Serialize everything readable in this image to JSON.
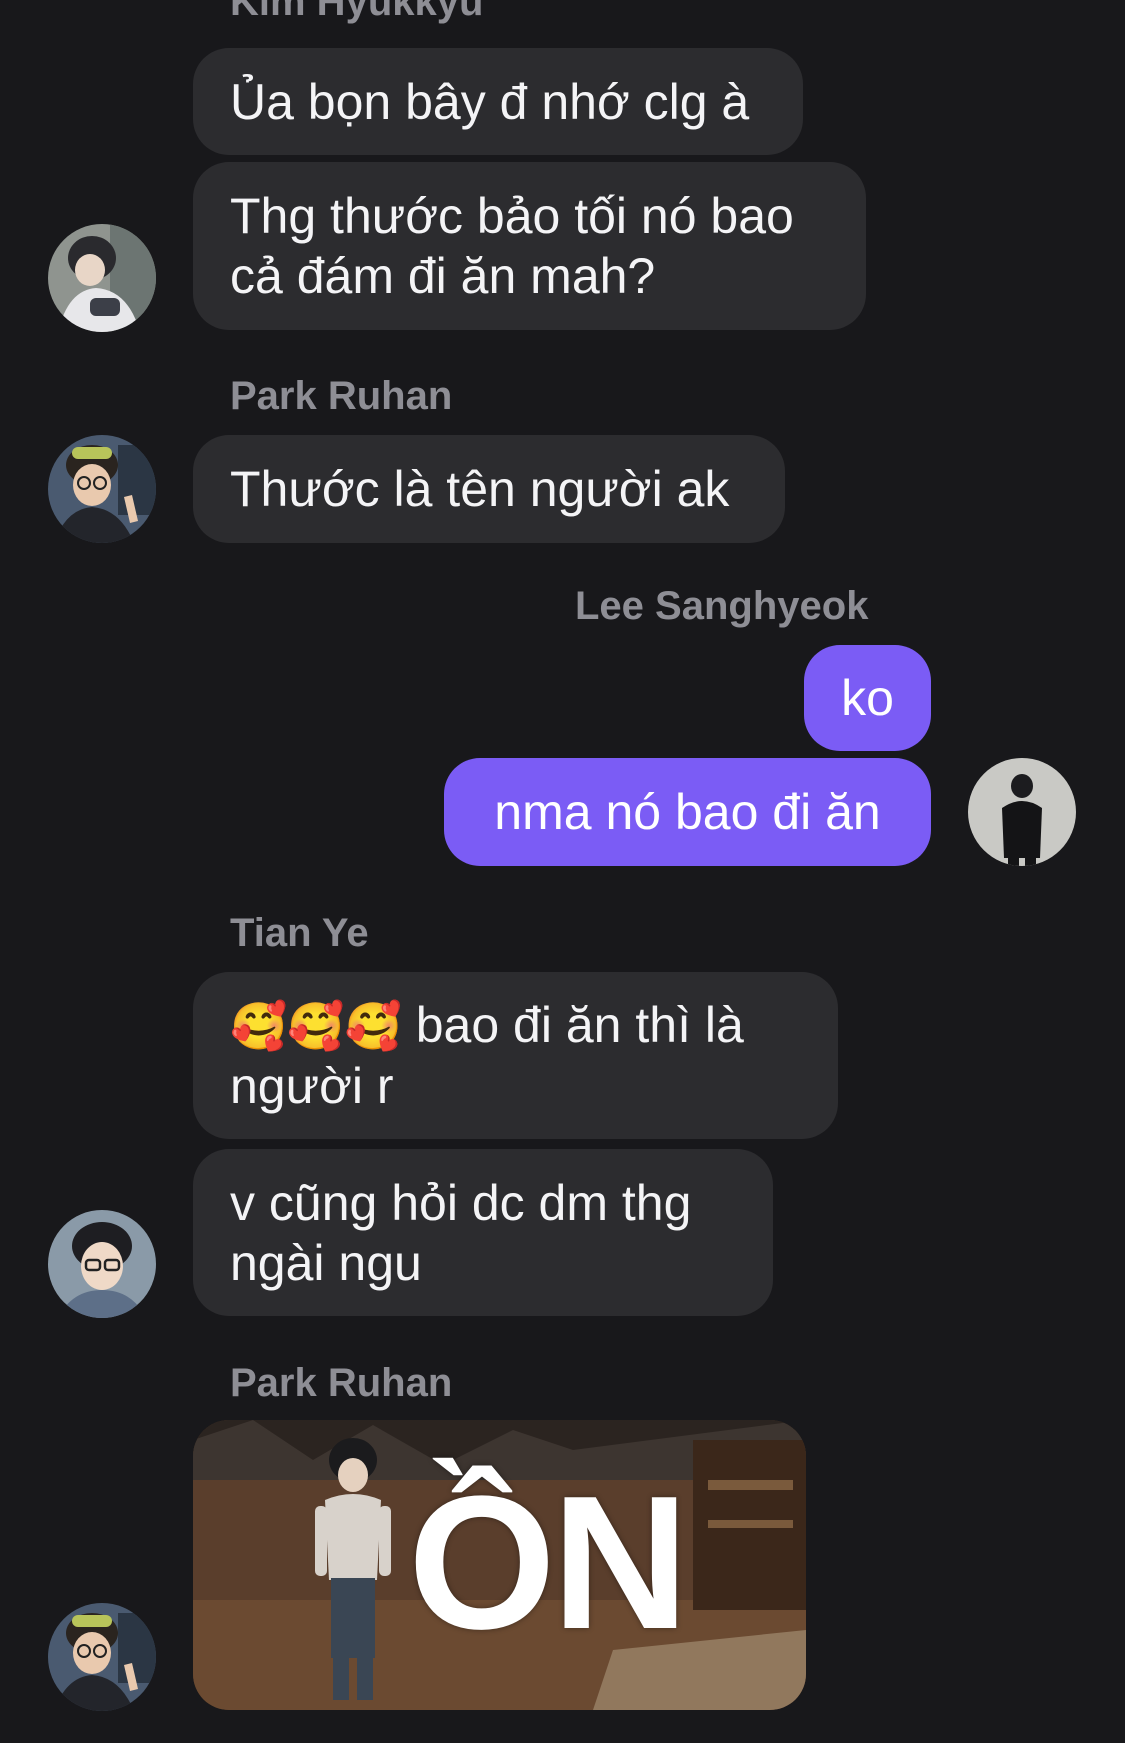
{
  "messages": {
    "kim": {
      "sender": "Kim Hyukkyu",
      "bubble1": "Ủa bọn bây đ nhớ clg à",
      "bubble2_line1": "Thg thước bảo tối nó bao",
      "bubble2_line2": "cả đám đi ăn mah?"
    },
    "park1": {
      "sender": "Park Ruhan",
      "bubble1": "Thước là tên người ak"
    },
    "lee": {
      "sender": "Lee Sanghyeok",
      "bubble1": "ko",
      "bubble2": "nma nó bao đi ăn"
    },
    "tian": {
      "sender": "Tian Ye",
      "bubble1_emoji": "🥰🥰🥰",
      "bubble1_line1": "bao đi ăn thì là",
      "bubble1_line2": "người r",
      "bubble2_line1": "v cũng hỏi dc dm thg",
      "bubble2_line2": "ngài ngu"
    },
    "park2": {
      "sender": "Park Ruhan",
      "image_text": "ỒN"
    }
  },
  "colors": {
    "background": "#18181b",
    "incoming_bubble": "#2c2c2f",
    "outgoing_bubble": "#7b5cf5",
    "sender_name": "#8e8e95"
  }
}
